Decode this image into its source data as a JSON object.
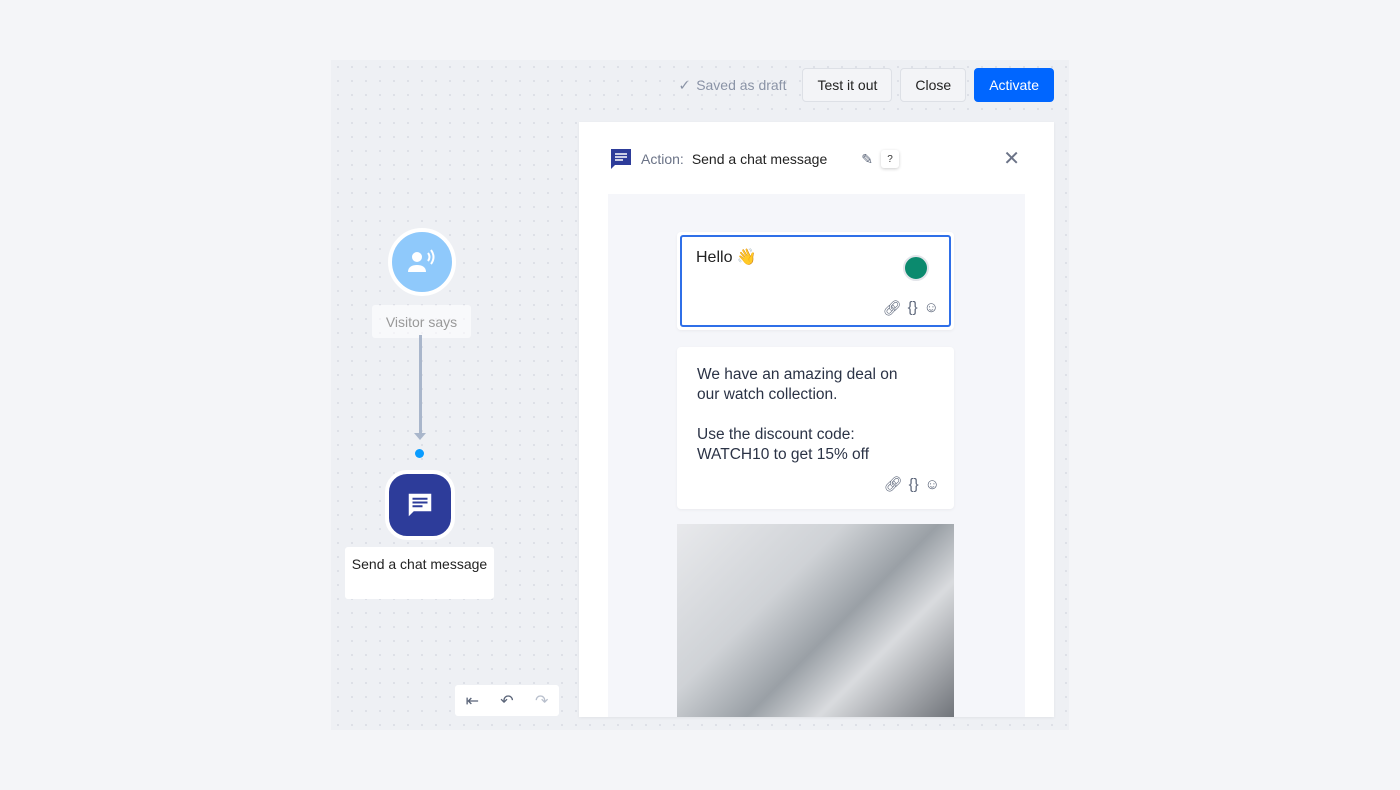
{
  "topbar": {
    "status": "Saved as draft",
    "test": "Test it out",
    "close": "Close",
    "activate": "Activate"
  },
  "flow": {
    "trigger": "Visitor says",
    "action": "Send a chat message"
  },
  "panel": {
    "prefix": "Action:",
    "title": "Send a chat message",
    "help": "?",
    "messages": [
      {
        "text": "Hello 👋"
      },
      {
        "line1": "We have an amazing deal on our watch collection.",
        "line2": "Use the discount code: WATCH10 to get 15% off"
      }
    ]
  },
  "colors": {
    "accent": "#0066ff",
    "action_node": "#2d3c9a",
    "trigger_node": "#8fc9fb"
  }
}
